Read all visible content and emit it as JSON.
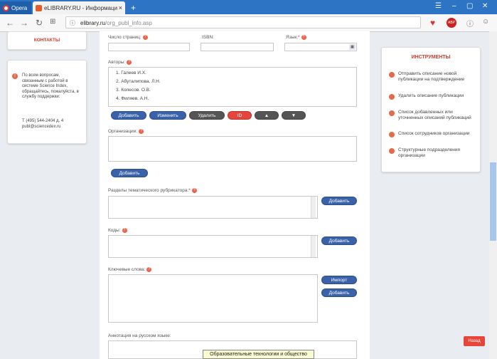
{
  "browser": {
    "opera_tab": "Opera",
    "active_tab": "eLIBRARY.RU - Информаци",
    "url_host": "elibrary.ru",
    "url_path": "/org_publ_info.asp"
  },
  "left": {
    "contacts_title": "КОНТАКТЫ",
    "help_text": "По всем вопросам, связанным с работой в системе Science Index, обращайтесь, пожалуйста, в службу поддержки:",
    "phone": "Т (495) 544-2404 д. 4",
    "email": "publ@sciencedex.ru"
  },
  "form": {
    "page_count_label": "Число страниц:",
    "isbn_label": "ISBN:",
    "language_label": "Язык:",
    "authors_label": "Авторы:",
    "authors": [
      "1.  Галеев И.Х.",
      "2.  Абуталипова. Л.Н.",
      "3.  Колесов. О.В.",
      "4.  Филяев. А.Н."
    ],
    "btn_add": "Добавить",
    "btn_edit": "Изменить",
    "btn_delete": "Удалить",
    "btn_id": "ID",
    "btn_up": "▲",
    "btn_down": "▼",
    "org_label": "Организации:",
    "org_add": "Добавить",
    "rubric_label": "Разделы тематического рубрикатора:",
    "rubric_add": "Добавить",
    "codes_label": "Коды:",
    "codes_add": "Добавить",
    "keywords_label": "Ключевые слова:",
    "keywords_import": "Импорт",
    "keywords_add": "Добавить",
    "annotation_label": "Аннотация на русском языке:"
  },
  "tools": {
    "title": "ИНСТРУМЕНТЫ",
    "items": [
      "Отправить описание новой публикации на подтверждение",
      "Удалить описание публикации",
      "Список добавленных или уточненных описаний публикаций",
      "Список сотрудников организации",
      "Структурные подразделения организации"
    ]
  },
  "tooltip": "Образовательные технологии и общество",
  "back_button": "Назад"
}
